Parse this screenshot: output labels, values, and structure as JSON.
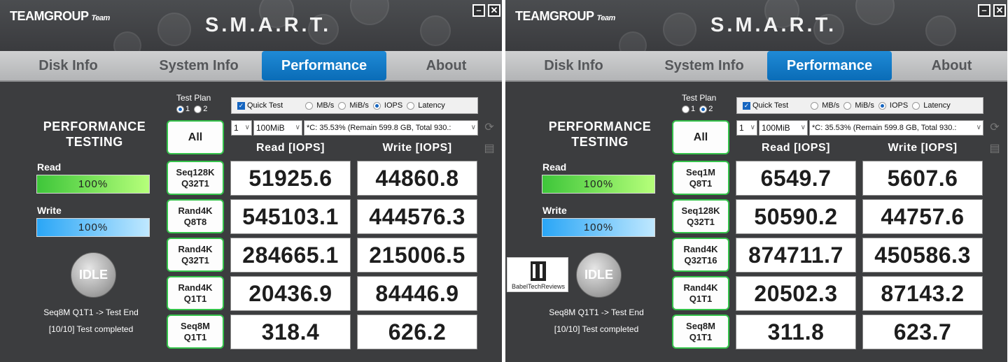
{
  "colors": {
    "accent_blue": "#0a6cb7",
    "green_border": "#34c24a",
    "read_bar": "#3ec63a",
    "write_bar": "#2aa6f6"
  },
  "windows": [
    {
      "brand": "TEAMGROUP",
      "brand_team": "Team",
      "title": "S.M.A.R.T.",
      "tabs": [
        "Disk Info",
        "System Info",
        "Performance",
        "About"
      ],
      "active_tab": "Performance",
      "side_title_1": "PERFORMANCE",
      "side_title_2": "TESTING",
      "read_label": "Read",
      "read_pct": "100%",
      "write_label": "Write",
      "write_pct": "100%",
      "idle": "IDLE",
      "status_1": "Seq8M Q1T1 -> Test End",
      "status_2": "[10/10] Test completed",
      "test_plan_label": "Test Plan",
      "test_plan_options": [
        "1",
        "2"
      ],
      "test_plan_selected": "1",
      "quick_test": "Quick Test",
      "unit_options": [
        "MB/s",
        "MiB/s",
        "IOPS",
        "Latency"
      ],
      "unit_selected": "IOPS",
      "count": "1",
      "size": "100MiB",
      "drive": "*C: 35.53% (Remain 599.8 GB, Total 930.:",
      "all": "All",
      "read_header": "Read [IOPS]",
      "write_header": "Write [IOPS]",
      "rows": [
        {
          "l1": "Seq128K",
          "l2": "Q32T1",
          "read": "51925.6",
          "write": "44860.8"
        },
        {
          "l1": "Rand4K",
          "l2": "Q8T8",
          "read": "545103.1",
          "write": "444576.3"
        },
        {
          "l1": "Rand4K",
          "l2": "Q32T1",
          "read": "284665.1",
          "write": "215006.5"
        },
        {
          "l1": "Rand4K",
          "l2": "Q1T1",
          "read": "20436.9",
          "write": "84446.9"
        },
        {
          "l1": "Seq8M",
          "l2": "Q1T1",
          "read": "318.4",
          "write": "626.2"
        }
      ]
    },
    {
      "brand": "TEAMGROUP",
      "brand_team": "Team",
      "title": "S.M.A.R.T.",
      "tabs": [
        "Disk Info",
        "System Info",
        "Performance",
        "About"
      ],
      "active_tab": "Performance",
      "side_title_1": "PERFORMANCE",
      "side_title_2": "TESTING",
      "read_label": "Read",
      "read_pct": "100%",
      "write_label": "Write",
      "write_pct": "100%",
      "idle": "IDLE",
      "status_1": "Seq8M Q1T1 -> Test End",
      "status_2": "[10/10] Test completed",
      "test_plan_label": "Test Plan",
      "test_plan_options": [
        "1",
        "2"
      ],
      "test_plan_selected": "2",
      "quick_test": "Quick Test",
      "unit_options": [
        "MB/s",
        "MiB/s",
        "IOPS",
        "Latency"
      ],
      "unit_selected": "IOPS",
      "count": "1",
      "size": "100MiB",
      "drive": "*C: 35.53% (Remain 599.8 GB, Total 930.:",
      "all": "All",
      "read_header": "Read [IOPS]",
      "write_header": "Write [IOPS]",
      "rows": [
        {
          "l1": "Seq1M",
          "l2": "Q8T1",
          "read": "6549.7",
          "write": "5607.6"
        },
        {
          "l1": "Seq128K",
          "l2": "Q32T1",
          "read": "50590.2",
          "write": "44757.6"
        },
        {
          "l1": "Rand4K",
          "l2": "Q32T16",
          "read": "874711.7",
          "write": "450586.3"
        },
        {
          "l1": "Rand4K",
          "l2": "Q1T1",
          "read": "20502.3",
          "write": "87143.2"
        },
        {
          "l1": "Seq8M",
          "l2": "Q1T1",
          "read": "311.8",
          "write": "623.7"
        }
      ]
    }
  ],
  "watermark": {
    "text": "BabelTechReviews"
  }
}
